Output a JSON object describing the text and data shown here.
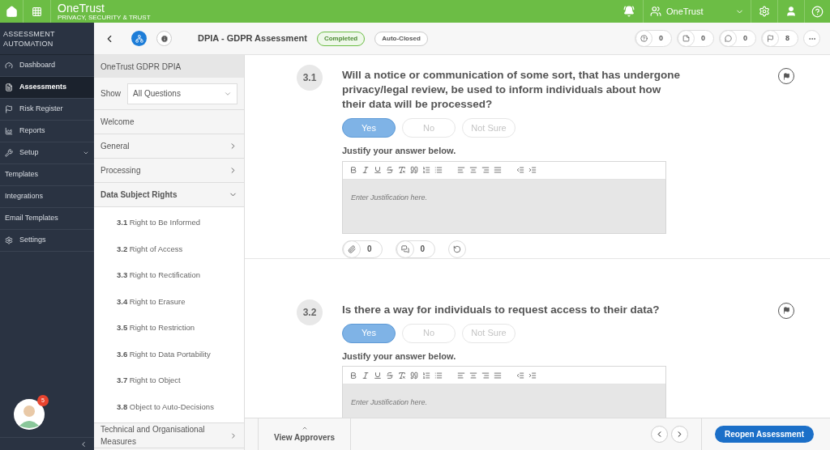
{
  "topbar": {
    "logo": "OneTrust",
    "tagline": "PRIVACY, SECURITY & TRUST",
    "org": "OneTrust"
  },
  "sidebar": {
    "title": "ASSESSMENT AUTOMATION",
    "items": [
      {
        "label": "Dashboard",
        "kind": "main",
        "selected": false
      },
      {
        "label": "Assessments",
        "kind": "main",
        "selected": true
      },
      {
        "label": "Risk Register",
        "kind": "main",
        "selected": false
      },
      {
        "label": "Reports",
        "kind": "main",
        "selected": false
      },
      {
        "label": "Setup",
        "kind": "group",
        "selected": false,
        "expanded": true
      },
      {
        "label": "Templates",
        "kind": "sub",
        "selected": false
      },
      {
        "label": "Integrations",
        "kind": "sub",
        "selected": false
      },
      {
        "label": "Email Templates",
        "kind": "sub",
        "selected": false
      },
      {
        "label": "Settings",
        "kind": "main",
        "selected": false
      }
    ],
    "avatar_badge": "5"
  },
  "header": {
    "title": "DPIA - GDPR Assessment",
    "badges": [
      {
        "label": "Completed",
        "kind": "success"
      },
      {
        "label": "Auto-Closed",
        "kind": "neutral"
      }
    ],
    "counters": [
      "0",
      "0",
      "0",
      "8"
    ]
  },
  "nav": {
    "title": "OneTrust GDPR DPIA",
    "show_label": "Show",
    "filter": "All Questions",
    "sections": [
      {
        "label": "Welcome",
        "kind": "plain",
        "expanded": false
      },
      {
        "label": "General",
        "kind": "group",
        "expanded": false
      },
      {
        "label": "Processing",
        "kind": "group",
        "expanded": false
      },
      {
        "label": "Data Subject Rights",
        "kind": "group",
        "expanded": true,
        "children": [
          {
            "number": "3.1",
            "label": "Right to Be Informed"
          },
          {
            "number": "3.2",
            "label": "Right of Access"
          },
          {
            "number": "3.3",
            "label": "Right to Rectification"
          },
          {
            "number": "3.4",
            "label": "Right to Erasure"
          },
          {
            "number": "3.5",
            "label": "Right to Restriction"
          },
          {
            "number": "3.6",
            "label": "Right to Data Portability"
          },
          {
            "number": "3.7",
            "label": "Right to Object"
          },
          {
            "number": "3.8",
            "label": "Object to Auto-Decisions"
          }
        ]
      },
      {
        "label": "Technical and Organisational Measures",
        "kind": "group",
        "expanded": false
      }
    ]
  },
  "questions": [
    {
      "number": "3.1",
      "text": "Will a notice or communication of some sort, that has undergone privacy/legal review, be used to inform individuals about how their data will be processed?",
      "options": [
        {
          "label": "Yes",
          "selected": true
        },
        {
          "label": "No",
          "selected": false
        },
        {
          "label": "Not Sure",
          "selected": false
        }
      ],
      "justify_label": "Justify your answer below.",
      "placeholder": "Enter Justification here.",
      "attachments": "0",
      "comments": "0"
    },
    {
      "number": "3.2",
      "text": "Is there a way for individuals to request access to their data?",
      "options": [
        {
          "label": "Yes",
          "selected": true
        },
        {
          "label": "No",
          "selected": false
        },
        {
          "label": "Not Sure",
          "selected": false
        }
      ],
      "justify_label": "Justify your answer below.",
      "placeholder": "Enter Justification here."
    }
  ],
  "footer": {
    "view_approvers": "View Approvers",
    "reopen": "Reopen Assessment"
  }
}
